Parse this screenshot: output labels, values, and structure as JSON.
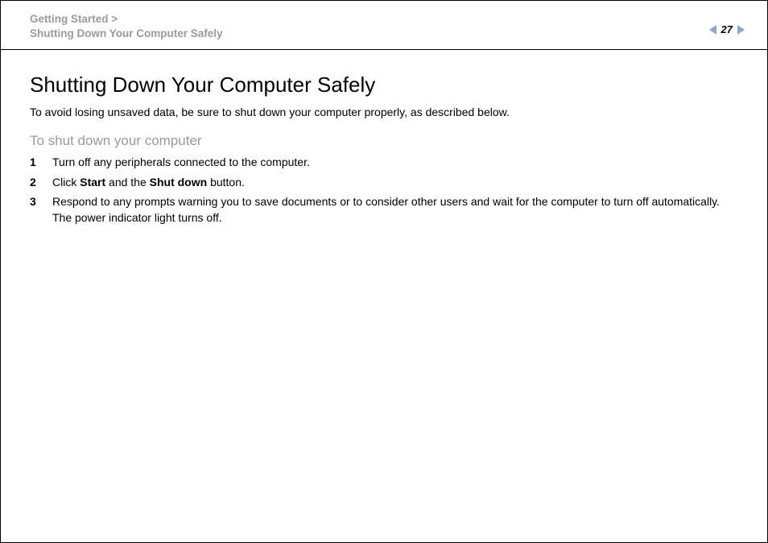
{
  "header": {
    "breadcrumb_line1": "Getting Started >",
    "breadcrumb_line2": "Shutting Down Your Computer Safely",
    "page_number": "27"
  },
  "content": {
    "title": "Shutting Down Your Computer Safely",
    "intro": "To avoid losing unsaved data, be sure to shut down your computer properly, as described below.",
    "subhead": "To shut down your computer",
    "steps": [
      {
        "num": "1",
        "text": "Turn off any peripherals connected to the computer."
      },
      {
        "num": "2",
        "prefix": "Click ",
        "bold1": "Start",
        "mid": " and the ",
        "bold2": "Shut down",
        "suffix": " button."
      },
      {
        "num": "3",
        "line1": "Respond to any prompts warning you to save documents or to consider other users and wait for the computer to turn off automatically.",
        "line2": "The power indicator light turns off."
      }
    ]
  }
}
